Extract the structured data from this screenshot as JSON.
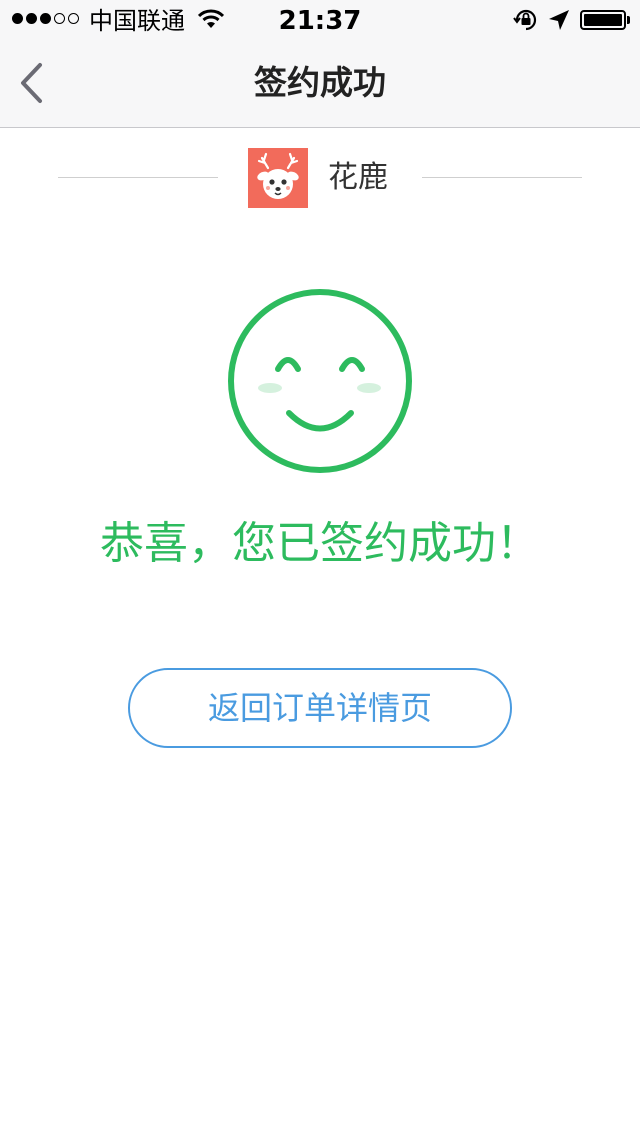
{
  "status_bar": {
    "carrier": "中国联通",
    "time": "21:37",
    "signal_bars_filled": 3,
    "signal_bars_total": 5,
    "icons": [
      "wifi-icon",
      "rotation-lock-icon",
      "location-arrow-icon",
      "battery-icon"
    ]
  },
  "nav": {
    "title": "签约成功",
    "back_icon": "chevron-left-icon"
  },
  "brand": {
    "name": "花鹿",
    "logo_icon": "deer-logo-icon",
    "logo_color": "#f26b5b"
  },
  "result": {
    "icon": "smiley-face-icon",
    "message": "恭喜，您已签约成功！",
    "accent_color": "#2dbb5e"
  },
  "actions": {
    "return_label": "返回订单详情页",
    "button_color": "#4a9be0"
  }
}
